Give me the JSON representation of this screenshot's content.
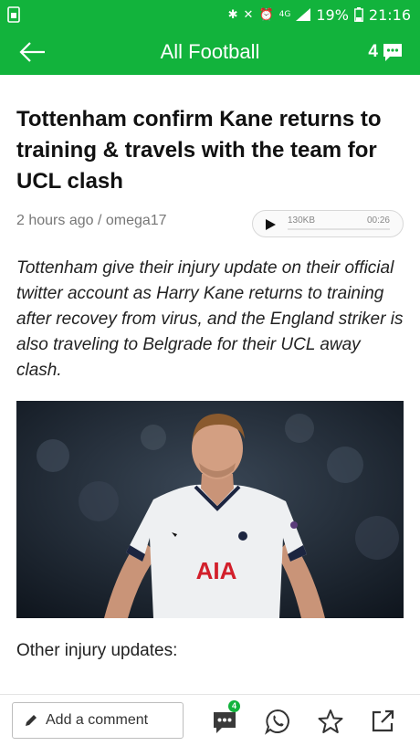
{
  "status_bar": {
    "network": "4G",
    "battery": "19%",
    "time": "21:16"
  },
  "app_bar": {
    "title": "All Football",
    "comment_count": "4"
  },
  "article": {
    "headline": "Tottenham confirm Kane returns to training & travels with the team for UCL clash",
    "meta": "2 hours ago / omega17",
    "audio": {
      "size": "130KB",
      "duration": "00:26"
    },
    "summary": "Tottenham give their injury update on their official twitter account as Harry Kane returns to training after recovey from virus, and the England striker is also traveling to Belgrade for their UCL away clash.",
    "photo": {
      "shirt_text": "AIA"
    },
    "subheading": "Other injury updates:"
  },
  "bottom_bar": {
    "comment_placeholder": "Add a comment",
    "comments_badge": "4"
  },
  "colors": {
    "brand_green": "#12b33c",
    "text_dark": "#111111",
    "meta_gray": "#777777"
  },
  "icons": [
    "sim-icon",
    "bluetooth-icon",
    "mute-icon",
    "alarm-icon",
    "signal-icon",
    "battery-icon",
    "back-arrow-icon",
    "comment-bubble-icon",
    "play-icon",
    "pencil-icon",
    "comments-icon",
    "whatsapp-icon",
    "star-icon",
    "share-icon"
  ]
}
